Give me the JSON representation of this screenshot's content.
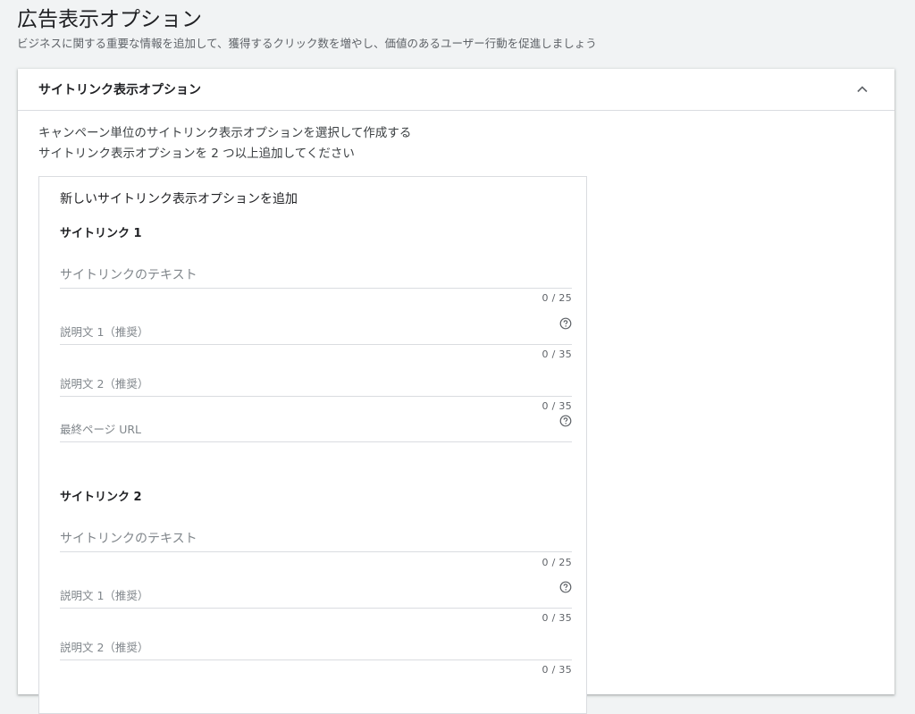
{
  "page": {
    "title": "広告表示オプション",
    "subtitle": "ビジネスに関する重要な情報を追加して、獲得するクリック数を増やし、価値のあるユーザー行動を促進しましょう"
  },
  "card": {
    "title": "サイトリンク表示オプション",
    "intro_line1": "キャンペーン単位のサイトリンク表示オプションを選択して作成する",
    "intro_line2": "サイトリンク表示オプションを 2 つ以上追加してください"
  },
  "form": {
    "heading": "新しいサイトリンク表示オプションを追加",
    "sitelinks": [
      {
        "title": "サイトリンク 1",
        "text_placeholder": "サイトリンクのテキスト",
        "text_value": "",
        "text_counter": "0 / 25",
        "desc1_placeholder": "説明文 1（推奨）",
        "desc1_value": "",
        "desc1_counter": "0 / 35",
        "desc2_placeholder": "説明文 2（推奨）",
        "desc2_value": "",
        "desc2_counter": "0 / 35",
        "url_placeholder": "最終ページ URL",
        "url_value": ""
      },
      {
        "title": "サイトリンク 2",
        "text_placeholder": "サイトリンクのテキスト",
        "text_value": "",
        "text_counter": "0 / 25",
        "desc1_placeholder": "説明文 1（推奨）",
        "desc1_value": "",
        "desc1_counter": "0 / 35",
        "desc2_placeholder": "説明文 2（推奨）",
        "desc2_value": "",
        "desc2_counter": "0 / 35"
      }
    ]
  },
  "icons": {
    "collapse": "chevron-up-icon",
    "help": "help-circle-icon"
  }
}
